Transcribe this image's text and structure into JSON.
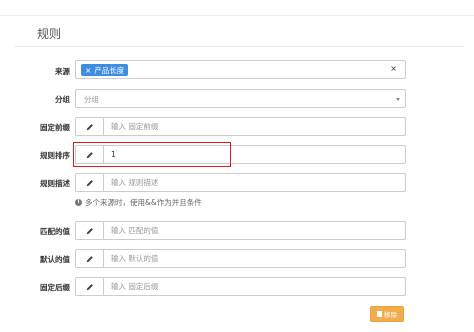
{
  "section": {
    "title": "规则"
  },
  "fields": {
    "source": {
      "label": "来源",
      "tag": "产品长度",
      "tag_remove": "×",
      "clear": "×"
    },
    "group": {
      "label": "分组",
      "placeholder": "分组"
    },
    "prefix": {
      "label": "固定前缀",
      "placeholder": "输入 固定前缀"
    },
    "sort": {
      "label": "规则排序",
      "value": "1"
    },
    "desc": {
      "label": "规则描述",
      "placeholder": "输入 规则描述"
    },
    "hint": "多个来源时，使用&&作为并且条件",
    "match": {
      "label": "匹配的值",
      "placeholder": "输入 匹配的值"
    },
    "default": {
      "label": "默认的值",
      "placeholder": "输入 默认的值"
    },
    "suffix": {
      "label": "固定后缀",
      "placeholder": "输入 固定后缀"
    }
  },
  "actions": {
    "remove": "移除"
  },
  "icons": {
    "edit": "pencil-icon",
    "info": "info-icon",
    "trash": "trash-icon"
  }
}
